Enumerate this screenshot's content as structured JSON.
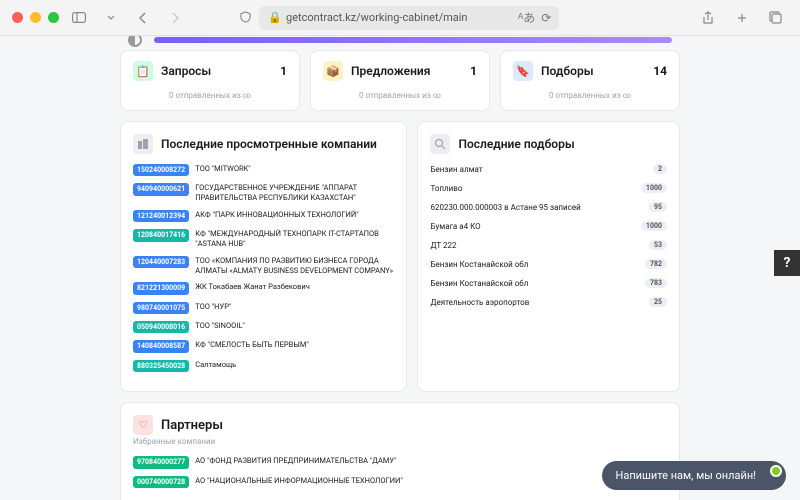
{
  "chrome": {
    "url": "getcontract.kz/working-cabinet/main"
  },
  "stats": {
    "requests": {
      "label": "Запросы",
      "count": "1",
      "sub": "0 отправленных из ∞"
    },
    "offers": {
      "label": "Предложения",
      "count": "1",
      "sub": "0 отправленных из ∞"
    },
    "selections": {
      "label": "Подборы",
      "count": "14",
      "sub": "0 отправленных из ∞"
    }
  },
  "recent_companies": {
    "title": "Последние просмотренные компании",
    "items": [
      {
        "badge": "150240008272",
        "color": "b-blue",
        "name": "ТОО \"MITWORK\""
      },
      {
        "badge": "940940000621",
        "color": "b-blue",
        "name": "ГОСУДАРСТВЕННОЕ УЧРЕЖДЕНИЕ \"АППАРАТ ПРАВИТЕЛЬСТВА РЕСПУБЛИКИ КАЗАХСТАН\""
      },
      {
        "badge": "121240012394",
        "color": "b-blue",
        "name": "АКФ \"ПАРК ИННОВАЦИОННЫХ ТЕХНОЛОГИЙ\""
      },
      {
        "badge": "120840017416",
        "color": "b-teal",
        "name": "КФ \"МЕЖДУНАРОДНЫЙ ТЕХНОПАРК IT-СТАРТАПОВ \"ASTANA HUB\""
      },
      {
        "badge": "120440007283",
        "color": "b-blue",
        "name": "ТОО «КОМПАНИЯ ПО РАЗВИТИЮ БИЗНЕСА ГОРОДА АЛМАТЫ «ALMATY BUSINESS DEVELOPMENT COMPANY»"
      },
      {
        "badge": "821221300009",
        "color": "b-blue",
        "name": "ЖК Токабаев Жанат Разбекович"
      },
      {
        "badge": "980740001075",
        "color": "b-blue",
        "name": "ТОО \"НУР\""
      },
      {
        "badge": "050940008016",
        "color": "b-teal",
        "name": "ТОО \"SINOOIL\""
      },
      {
        "badge": "140840008587",
        "color": "b-blue",
        "name": "КФ \"СМЕЛОСТЬ БЫТЬ ПЕРВЫМ\""
      },
      {
        "badge": "880325450028",
        "color": "b-teal",
        "name": "Салтамощь"
      }
    ]
  },
  "recent_selections": {
    "title": "Последние подборы",
    "items": [
      {
        "name": "Бензин алмат",
        "count": "2"
      },
      {
        "name": "Топливо",
        "count": "1000"
      },
      {
        "name": "620230.000.000003 в Астане 95 записей",
        "count": "95"
      },
      {
        "name": "Бумага а4 КО",
        "count": "1000"
      },
      {
        "name": "ДТ 222",
        "count": "53"
      },
      {
        "name": "Бензин Костанайской обл",
        "count": "782"
      },
      {
        "name": "Бензин Костанайской обл",
        "count": "783"
      },
      {
        "name": "Деятельность аэропортов",
        "count": "25"
      }
    ]
  },
  "partners": {
    "title": "Партнеры",
    "subtitle": "Избранные компании",
    "items": [
      {
        "badge": "970840000277",
        "name": "АО \"ФОНД РАЗВИТИЯ ПРЕДПРИНИМАТЕЛЬСТВА \"ДАМУ\""
      },
      {
        "badge": "000740000728",
        "name": "АО \"НАЦИОНАЛЬНЫЕ ИНФОРМАЦИОННЫЕ ТЕХНОЛОГИИ\""
      }
    ]
  },
  "chat": {
    "label": "Напишите нам, мы онлайн!"
  },
  "help": {
    "label": "?"
  }
}
